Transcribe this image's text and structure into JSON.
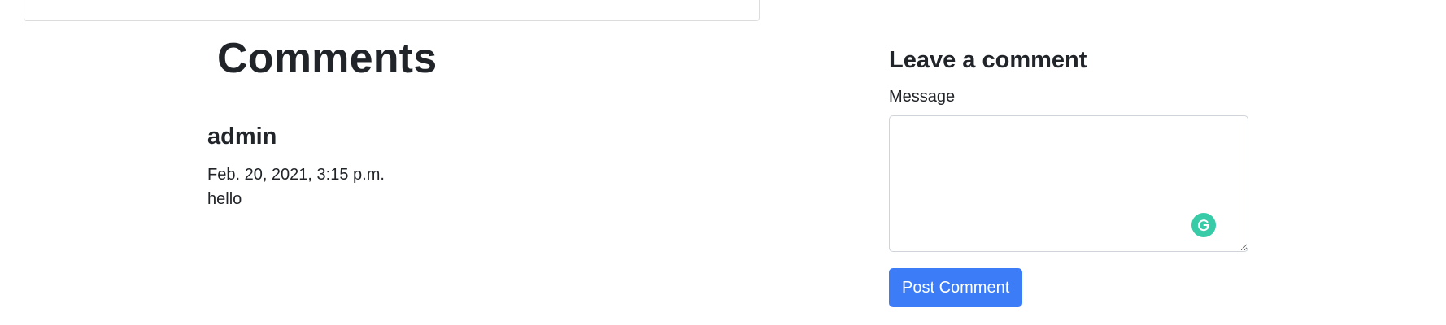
{
  "comments_section": {
    "title": "Comments",
    "items": [
      {
        "author": "admin",
        "date": "Feb. 20, 2021, 3:15 p.m.",
        "body": "hello"
      }
    ]
  },
  "comment_form": {
    "title": "Leave a comment",
    "message_label": "Message",
    "message_value": "",
    "submit_label": "Post Comment",
    "grammarly_icon": "grammarly-icon"
  },
  "colors": {
    "primary_button": "#3d7cf7",
    "grammarly": "#15c39a",
    "text": "#212529",
    "border": "#ced4da"
  }
}
